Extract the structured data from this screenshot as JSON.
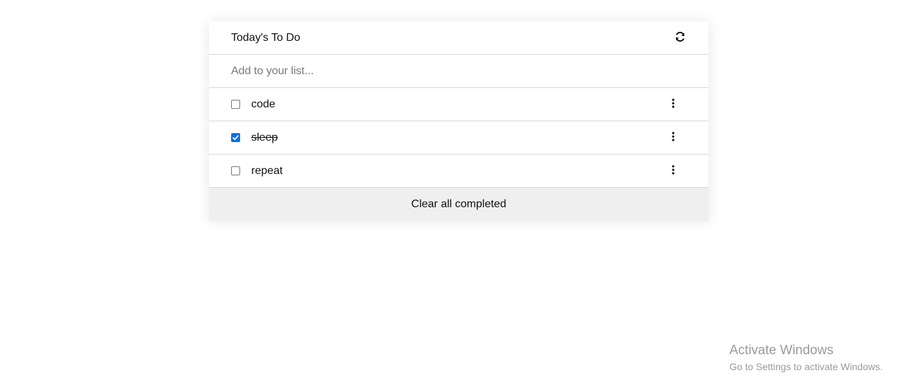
{
  "todo": {
    "title": "Today's To Do",
    "refresh_icon": "refresh-icon",
    "input_placeholder": "Add to your list...",
    "input_value": "",
    "items": [
      {
        "label": "code",
        "checked": false
      },
      {
        "label": "sleep",
        "checked": true
      },
      {
        "label": "repeat",
        "checked": false
      }
    ],
    "item_menu_icon": "vertical-ellipsis-icon",
    "clear_label": "Clear all completed"
  },
  "watermark": {
    "title": "Activate Windows",
    "subtitle": "Go to Settings to activate Windows."
  },
  "colors": {
    "accent": "#0b6fe8",
    "footer_bg": "#efefef",
    "divider": "#d8d8d8"
  }
}
